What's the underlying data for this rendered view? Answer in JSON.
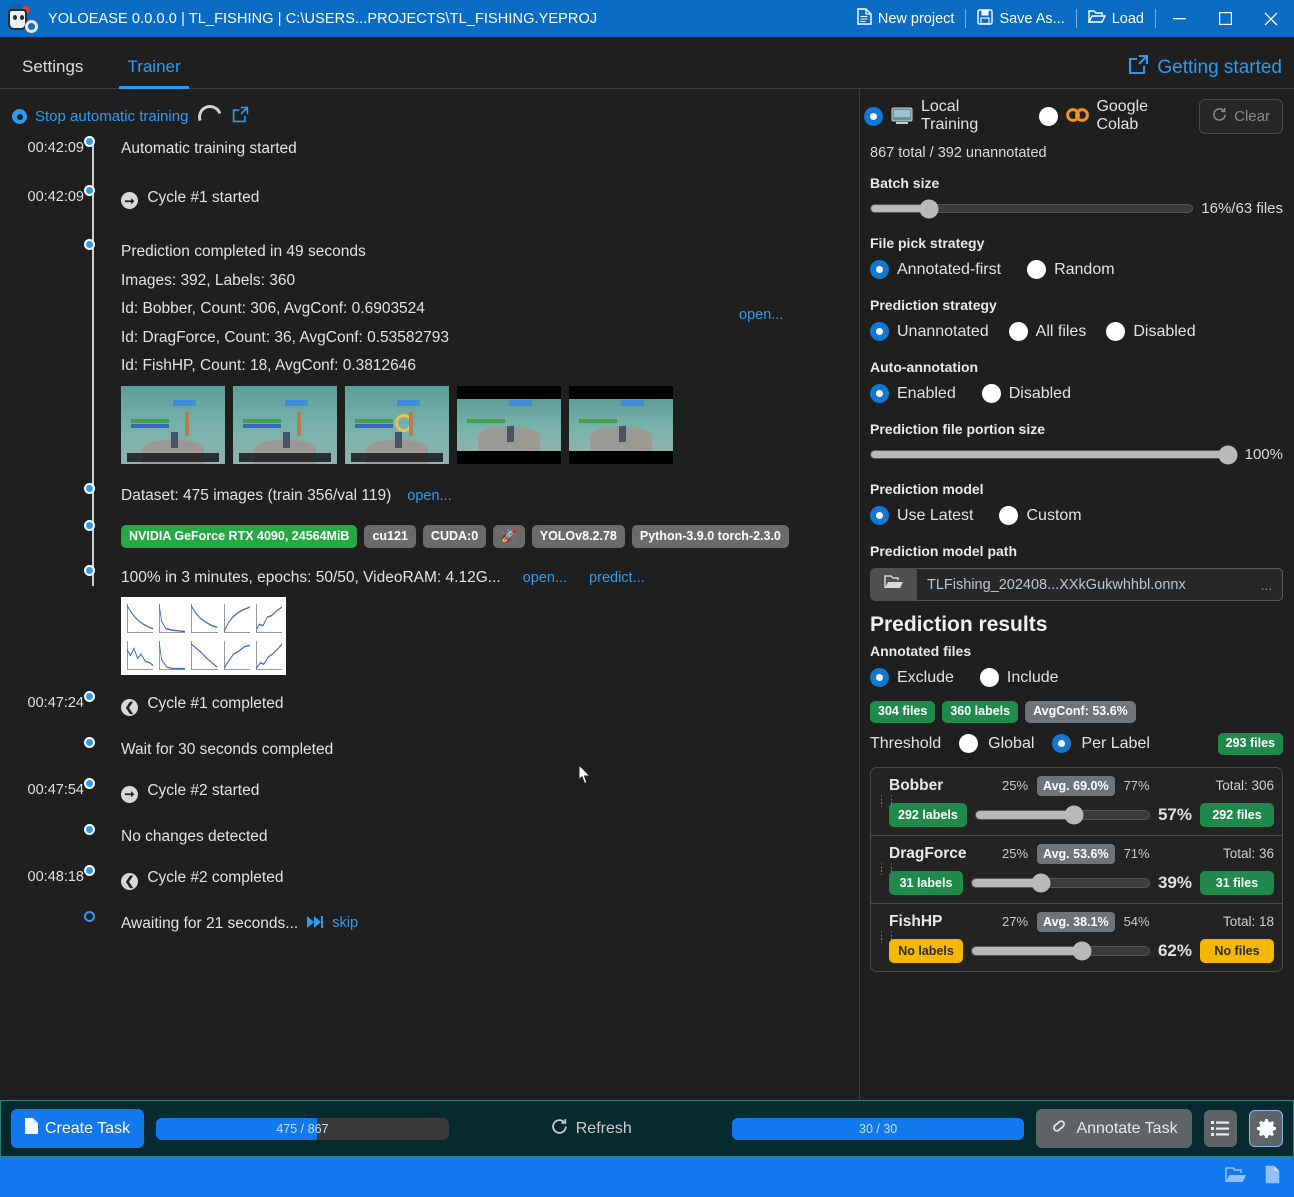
{
  "titlebar": {
    "title": "YOLOEASE 0.0.0.0 | TL_FISHING | C:\\USERS...PROJECTS\\TL_FISHING.YEPROJ",
    "new_project": "New project",
    "save_as": "Save As...",
    "load": "Load"
  },
  "tabs": [
    {
      "label": "Settings",
      "active": false
    },
    {
      "label": "Trainer",
      "active": true
    }
  ],
  "getting_started": "Getting started",
  "left_toolbar": {
    "stop_automatic_training": "Stop automatic training"
  },
  "timeline": [
    {
      "time": "00:42:09",
      "text": "Automatic training started",
      "icon": "",
      "dot": "filled"
    },
    {
      "time": "00:42:09",
      "text": "Cycle #1 started",
      "icon": "arrow-right-circle",
      "dot": "filled"
    },
    {
      "time": "",
      "text": "Prediction completed in 49 seconds",
      "icon": "",
      "dot": "filled",
      "sublines": [
        "Images: 392, Labels: 360",
        "Id: Bobber, Count: 306, AvgConf: 0.6903524",
        "Id: DragForce, Count: 36, AvgConf: 0.53582793",
        "Id: FishHP, Count: 18, AvgConf: 0.3812646"
      ],
      "open_link": "open...",
      "thumbnails": 5
    },
    {
      "time": "",
      "text": "Dataset: 475 images (train 356/val 119)",
      "icon": "",
      "dot": "filled",
      "open_link": "open..."
    },
    {
      "time": "",
      "dot": "filled",
      "chips": [
        {
          "text": "NVIDIA GeForce RTX 4090, 24564MiB",
          "color": "green"
        },
        {
          "text": "cu121",
          "color": "grey"
        },
        {
          "text": "CUDA:0",
          "color": "grey"
        },
        {
          "text": "🚀",
          "color": "grey"
        },
        {
          "text": "YOLOv8.2.78",
          "color": "grey"
        },
        {
          "text": "Python-3.9.0 torch-2.3.0",
          "color": "grey"
        }
      ]
    },
    {
      "time": "",
      "text": "100% in 3 minutes, epochs: 50/50, VideoRAM: 4.12G...",
      "icon": "",
      "dot": "filled",
      "open_link": "open...",
      "predict_link": "predict...",
      "results_chart": true
    },
    {
      "time": "00:47:24",
      "text": "Cycle #1 completed",
      "icon": "arrow-left-circle",
      "dot": "filled"
    },
    {
      "time": "",
      "text": "Wait for 30 seconds completed",
      "icon": "",
      "dot": "filled"
    },
    {
      "time": "00:47:54",
      "text": "Cycle #2 started",
      "icon": "arrow-right-circle",
      "dot": "filled"
    },
    {
      "time": "",
      "text": "No changes detected",
      "icon": "",
      "dot": "filled"
    },
    {
      "time": "00:48:18",
      "text": "Cycle #2 completed",
      "icon": "arrow-left-circle",
      "dot": "filled"
    },
    {
      "time": "",
      "text": "Awaiting for 21 seconds...",
      "icon": "",
      "dot": "hollow",
      "skip_link": "skip"
    }
  ],
  "right_panel": {
    "training_mode": {
      "local": "Local Training",
      "colab": "Google Colab",
      "selected": "local"
    },
    "clear_label": "Clear",
    "files_stat": "867 total / 392 unannotated",
    "batch_size": {
      "label": "Batch size",
      "value_text": "16%/63 files",
      "percent": 16
    },
    "file_pick_strategy": {
      "label": "File pick strategy",
      "options": [
        "Annotated-first",
        "Random"
      ],
      "selected": "Annotated-first"
    },
    "prediction_strategy": {
      "label": "Prediction strategy",
      "options": [
        "Unannotated",
        "All files",
        "Disabled"
      ],
      "selected": "Unannotated"
    },
    "auto_annotation": {
      "label": "Auto-annotation",
      "options": [
        "Enabled",
        "Disabled"
      ],
      "selected": "Enabled"
    },
    "prediction_file_portion": {
      "label": "Prediction file portion size",
      "value_text": "100%",
      "percent": 100
    },
    "prediction_model": {
      "label": "Prediction model",
      "options": [
        "Use Latest",
        "Custom"
      ],
      "selected": "Use Latest"
    },
    "prediction_model_path": {
      "label": "Prediction model path",
      "value": "TLFishing_202408...XXkGukwhhbl.onnx",
      "browse_label": "..."
    },
    "prediction_results": {
      "title": "Prediction results",
      "annotated_files_label": "Annotated files",
      "annotated_files_options": [
        "Exclude",
        "Include"
      ],
      "annotated_files_selected": "Exclude",
      "badges": [
        {
          "text": "304 files",
          "color": "green"
        },
        {
          "text": "360 labels",
          "color": "green"
        },
        {
          "text": "AvgConf: 53.6%",
          "color": "grey"
        }
      ],
      "threshold_label": "Threshold",
      "threshold_options": [
        "Global",
        "Per Label"
      ],
      "threshold_selected": "Per Label",
      "threshold_files_badge": "293 files"
    },
    "labels": [
      {
        "name": "Bobber",
        "min": "25%",
        "avg": "Avg. 69.0%",
        "max": "77%",
        "total": "Total: 306",
        "labels_chip": "292 labels",
        "labels_chip_color": "green",
        "files_chip": "292 files",
        "files_chip_color": "green",
        "threshold_pct": "57%",
        "slider_percent": 57
      },
      {
        "name": "DragForce",
        "min": "25%",
        "avg": "Avg. 53.6%",
        "max": "71%",
        "total": "Total: 36",
        "labels_chip": "31 labels",
        "labels_chip_color": "green",
        "files_chip": "31 files",
        "files_chip_color": "green",
        "threshold_pct": "39%",
        "slider_percent": 39
      },
      {
        "name": "FishHP",
        "min": "27%",
        "avg": "Avg. 38.1%",
        "max": "54%",
        "total": "Total: 18",
        "labels_chip": "No labels",
        "labels_chip_color": "amber",
        "files_chip": "No files",
        "files_chip_color": "amber",
        "threshold_pct": "62%",
        "slider_percent": 62
      }
    ]
  },
  "bottom_bar": {
    "create_task": "Create Task",
    "progress_left": "475 / 867",
    "progress_left_percent": 55,
    "refresh": "Refresh",
    "progress_right": "30 / 30",
    "progress_right_percent": 100,
    "annotate_task": "Annotate Task"
  }
}
